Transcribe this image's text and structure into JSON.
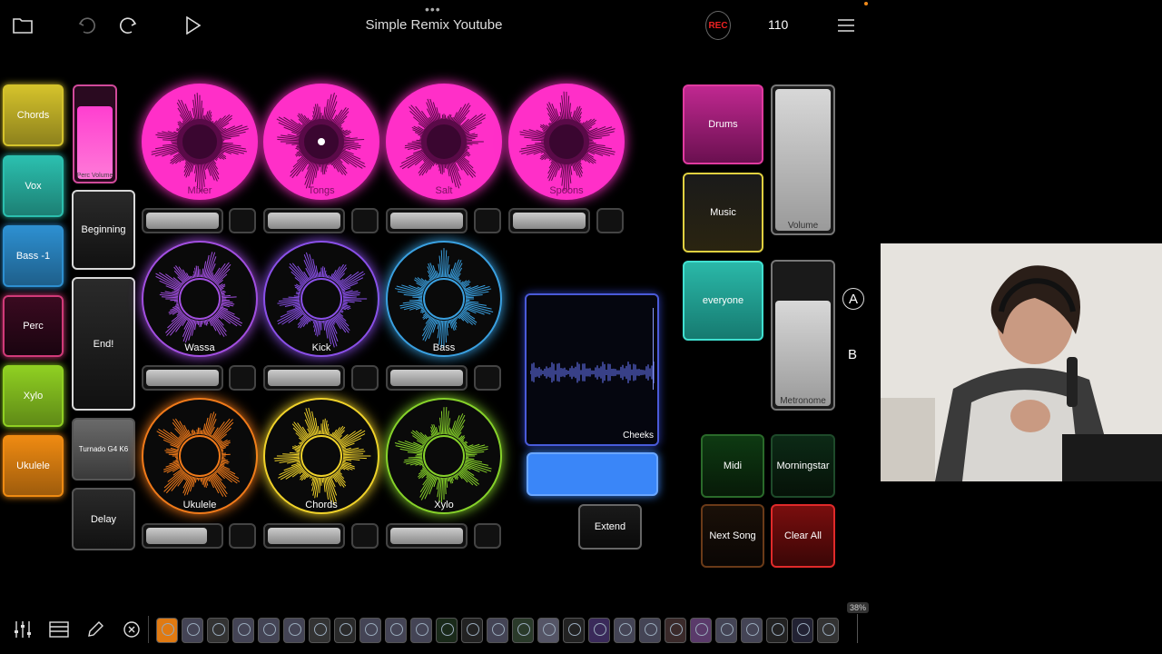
{
  "topbar": {
    "title": "Simple Remix Youtube",
    "dots": "•••",
    "rec_label": "REC",
    "tempo": "110"
  },
  "left_column": [
    {
      "label": "Chords",
      "color": "#d4c22b"
    },
    {
      "label": "Vox",
      "color": "#2bbfae"
    },
    {
      "label": "Bass -1",
      "color": "#2d8fd0"
    },
    {
      "label": "Perc",
      "color": "#d03a78"
    },
    {
      "label": "Xylo",
      "color": "#8fcf22"
    },
    {
      "label": "Ukulele",
      "color": "#ee8a12"
    }
  ],
  "controls": {
    "perc_volume": "Perc Volume",
    "beginning": "Beginning",
    "end": "End!",
    "turnado": "Turnado G4 K6",
    "delay": "Delay",
    "extend": "Extend"
  },
  "loops": [
    {
      "label": "Mixer",
      "color": "#ff2fc8"
    },
    {
      "label": "Tongs",
      "color": "#ff2fc8"
    },
    {
      "label": "Salt",
      "color": "#ff2fc8"
    },
    {
      "label": "Spoons",
      "color": "#ff2fc8"
    },
    {
      "label": "Wassa",
      "color": "#a24fe0"
    },
    {
      "label": "Kick",
      "color": "#8a50e8"
    },
    {
      "label": "Bass",
      "color": "#3aa0e0"
    },
    {
      "label": "Ukulele",
      "color": "#f07a1a"
    },
    {
      "label": "Chords",
      "color": "#f0d22a"
    },
    {
      "label": "Xylo",
      "color": "#86d22a"
    }
  ],
  "sampler": {
    "label": "Cheeks"
  },
  "right_pads": {
    "drums": "Drums",
    "music": "Music",
    "everyone": "everyone",
    "volume": "Volume",
    "metronome": "Metronome",
    "a": "A",
    "b": "B",
    "midi": "Midi",
    "morningstar": "Morningstar",
    "next_song": "Next Song",
    "clear_all": "Clear All"
  },
  "bottom": {
    "cpu": "38%"
  }
}
